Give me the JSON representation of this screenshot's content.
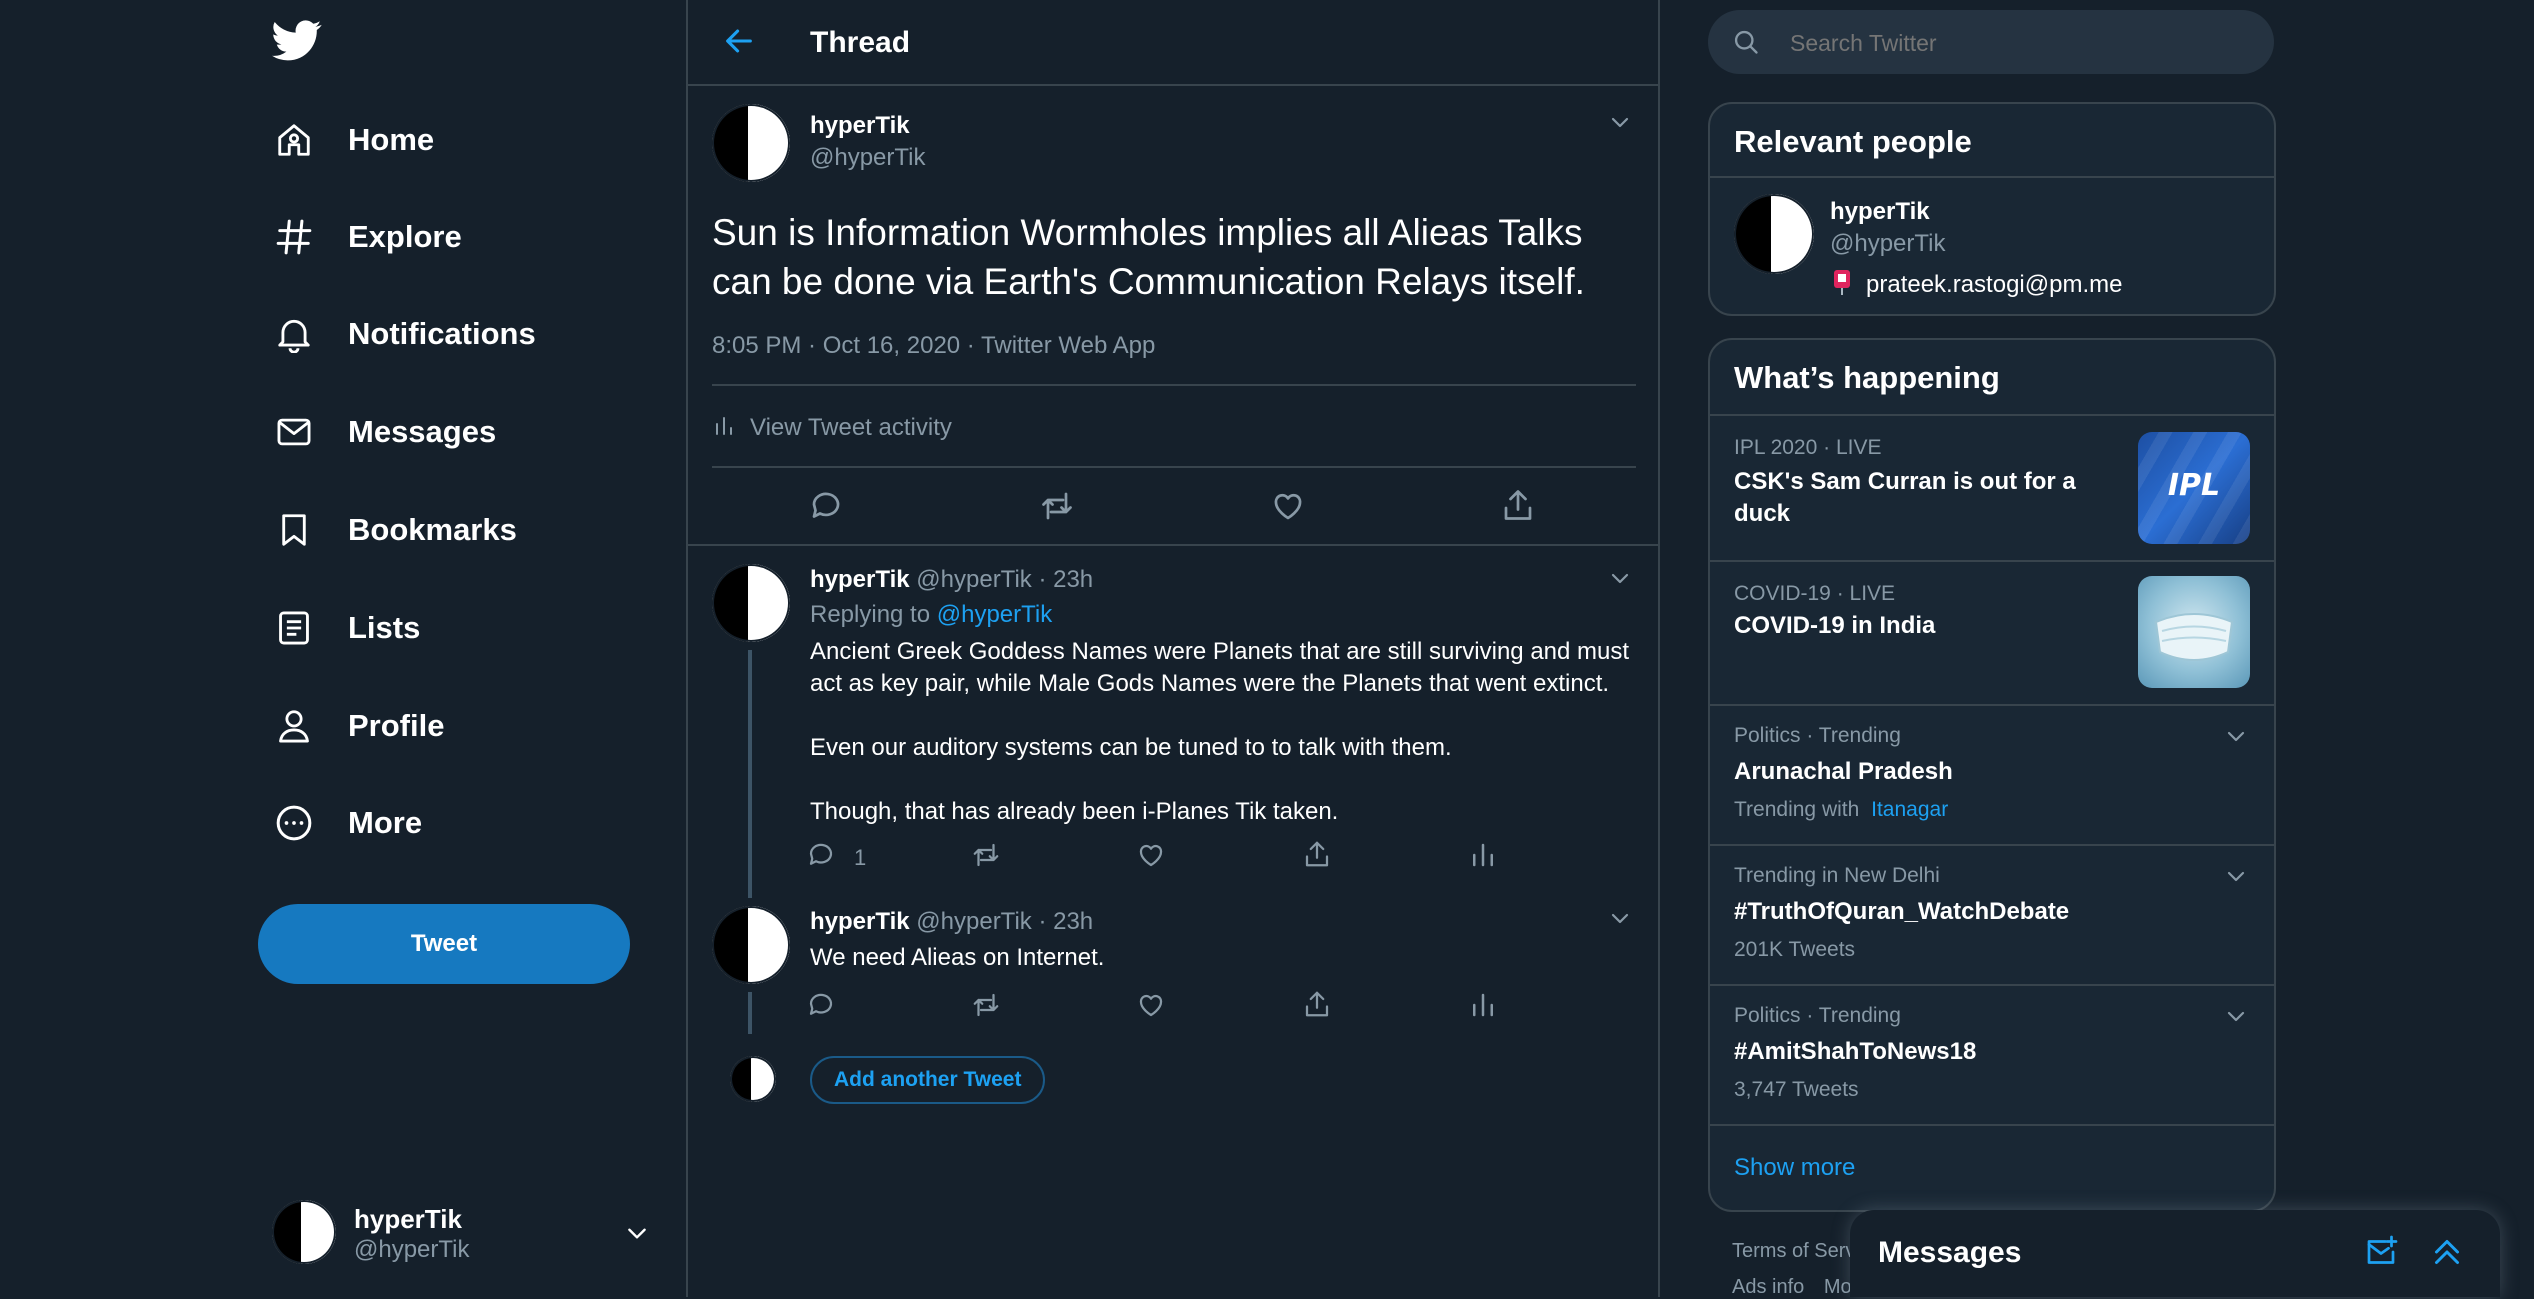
{
  "nav": {
    "items": [
      {
        "label": "Home",
        "icon": "home-icon"
      },
      {
        "label": "Explore",
        "icon": "hashtag-icon"
      },
      {
        "label": "Notifications",
        "icon": "bell-icon"
      },
      {
        "label": "Messages",
        "icon": "envelope-icon"
      },
      {
        "label": "Bookmarks",
        "icon": "bookmark-icon"
      },
      {
        "label": "Lists",
        "icon": "list-icon"
      },
      {
        "label": "Profile",
        "icon": "person-icon"
      },
      {
        "label": "More",
        "icon": "more-circle-icon"
      }
    ],
    "tweet_label": "Tweet"
  },
  "account": {
    "name": "hyperTik",
    "handle": "@hyperTik"
  },
  "header": {
    "title": "Thread"
  },
  "main_tweet": {
    "name": "hyperTik",
    "handle": "@hyperTik",
    "text_line1": "Sun is Information Wormholes implies all Alieas Talks",
    "text_line2": "can be done via Earth's Communication Relays itself.",
    "meta": "8:05 PM · Oct 16, 2020 · Twitter Web App",
    "activity": "View Tweet activity"
  },
  "replies": [
    {
      "name": "hyperTik",
      "handle_time": "@hyperTik · 23h",
      "replying_prefix": "Replying to",
      "replying_to": "@hyperTik",
      "p1_line1": "Ancient Greek Goddess Names were Planets that are still surviving and must",
      "p1_line2": "act as key pair, while Male Gods Names were the Planets that went extinct.",
      "p2": "Even our auditory systems can be tuned to to talk with them.",
      "p3": "Though, that has already been i-Planes Tik taken.",
      "reply_count": "1"
    },
    {
      "name": "hyperTik",
      "handle_time": "@hyperTik · 23h",
      "text": "We need Alieas on Internet."
    }
  ],
  "add_tweet_label": "Add another Tweet",
  "search": {
    "placeholder": "Search Twitter"
  },
  "relevant": {
    "title": "Relevant people",
    "name": "hyperTik",
    "handle": "@hyperTik",
    "bio_email": "prateek.rastogi@pm.me"
  },
  "happening": {
    "title": "What’s happening",
    "trends": [
      {
        "category": "IPL 2020 · LIVE",
        "title_line1": "CSK's Sam Curran is out for a",
        "title_line2": "duck",
        "image": "ipl-logo-image"
      },
      {
        "category": "COVID-19 · LIVE",
        "title_line1": "COVID-19 in India",
        "image": "face-mask-image"
      },
      {
        "category": "Politics · Trending",
        "title_line1": "Arunachal Pradesh",
        "sub_prefix": "Trending with",
        "sub_link": "Itanagar"
      },
      {
        "category": "Trending in New Delhi",
        "title_line1": "#TruthOfQuran_WatchDebate",
        "sub": "201K Tweets"
      },
      {
        "category": "Politics · Trending",
        "title_line1": "#AmitShahToNews18",
        "sub": "3,747 Tweets"
      }
    ],
    "show_more": "Show more",
    "ipl_badge": "IPL"
  },
  "footer": {
    "terms": "Terms of Serv",
    "ads": "Ads info",
    "more": "Mo"
  },
  "messages_dock": {
    "title": "Messages"
  },
  "colors": {
    "background": "#15202b",
    "accent": "#1da1f2",
    "tweet_button": "#1679c0",
    "muted": "#8899a6",
    "border": "#38444d"
  }
}
